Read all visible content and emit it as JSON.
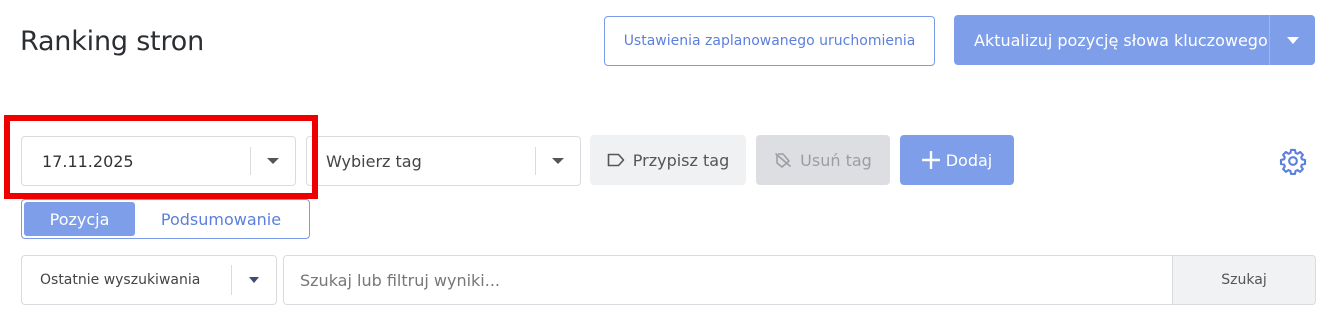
{
  "header": {
    "title": "Ranking stron",
    "schedule_button_label": "Ustawienia zaplanowanego uruchomienia",
    "update_button_label": "Aktualizuj pozycję słowa kluczowego"
  },
  "filters": {
    "date_value": "17.11.2025",
    "tag_select_placeholder": "Wybierz tag",
    "assign_tag_label": "Przypisz tag",
    "remove_tag_label": "Usuń tag",
    "add_label": "Dodaj"
  },
  "view_toggle": {
    "options": [
      "Pozycja",
      "Podsumowanie"
    ],
    "active": "Pozycja"
  },
  "search": {
    "recent_label": "Ostatnie wyszukiwania",
    "placeholder": "Szukaj lub filtruj wyniki...",
    "button_label": "Szukaj"
  },
  "colors": {
    "accent": "#7e9ee9",
    "accent_text": "#5b7fdc",
    "highlight": "#ee0000"
  },
  "icons": [
    "caret-down-icon",
    "tag-icon",
    "tag-off-icon",
    "plus-icon",
    "gear-icon"
  ]
}
